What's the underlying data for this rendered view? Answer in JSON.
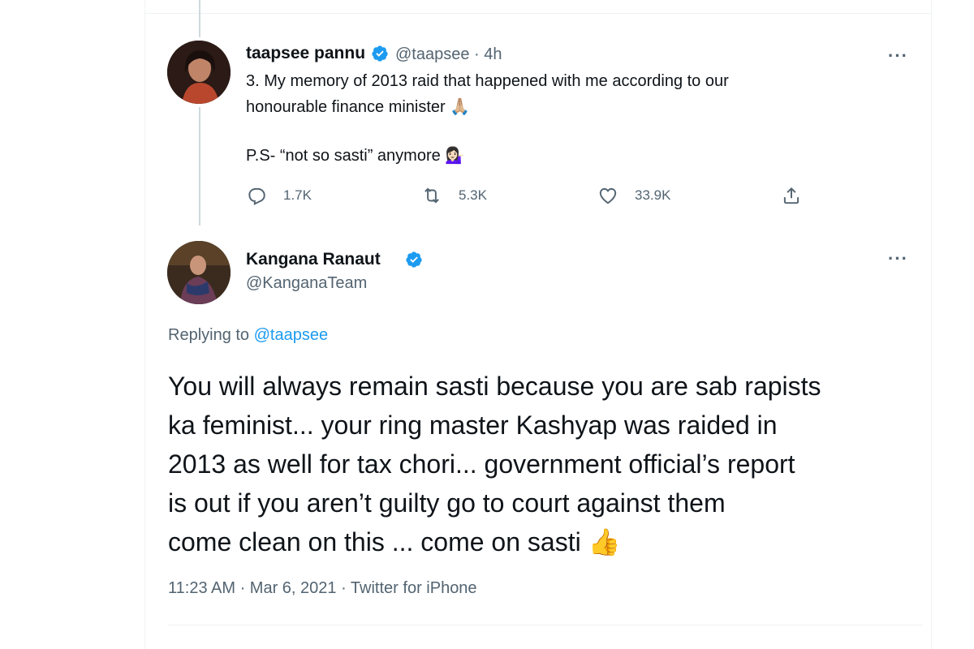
{
  "tweet1": {
    "name": "taapsee pannu",
    "handle": "@taapsee",
    "time": "4h",
    "text_lines": [
      "3. My memory of 2013 raid that happened with me according to our",
      "honourable finance minister 🙏🏼",
      "P.S- “not so sasti” anymore 💁🏻‍♀️"
    ],
    "stats": {
      "replies": "1.7K",
      "retweets": "5.3K",
      "likes": "33.9K"
    },
    "more": "···"
  },
  "tweet2": {
    "name": "Kangana Ranaut",
    "handle": "@KanganaTeam",
    "more": "···",
    "replying_prefix": "Replying to",
    "replying_to": "@taapsee",
    "text": "You will always remain sasti because you are sab rapists\nka feminist... your ring master Kashyap was raided in\n2013 as well for tax chori... government official’s  report\nis out if you aren’t guilty go to court against them\ncome clean on this ... come on sasti 👍",
    "meta": "11:23 AM · Mar 6, 2021 · Twitter for iPhone"
  },
  "colors": {
    "verified": "#1d9bf0",
    "mention": "#1d9bf0",
    "muted": "#536471"
  },
  "icons": {
    "reply": "reply-icon",
    "retweet": "retweet-icon",
    "like": "heart-icon",
    "share": "share-icon",
    "verified": "verified-badge-icon"
  }
}
